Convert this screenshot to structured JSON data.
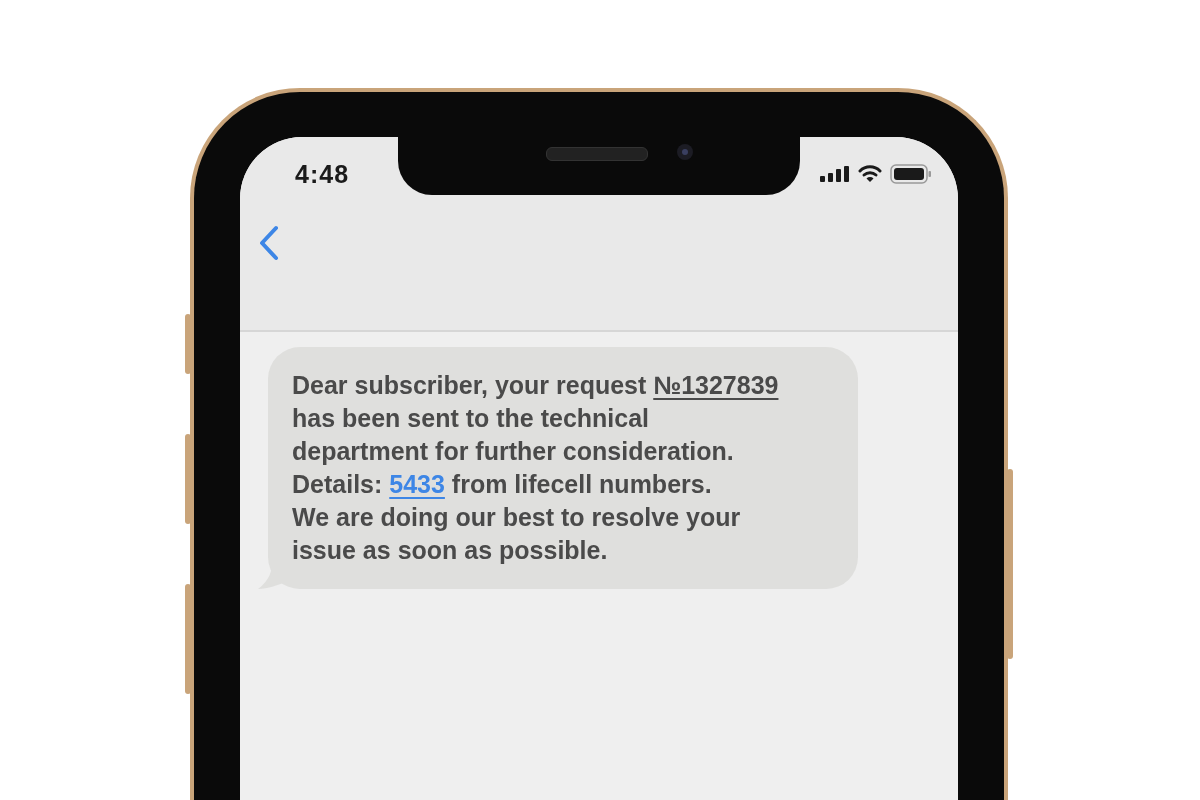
{
  "status_bar": {
    "time": "4:48"
  },
  "message": {
    "lines": [
      [
        {
          "kind": "text",
          "text": "Dear subscriber, your request "
        },
        {
          "kind": "underlined",
          "text": "№1327839"
        }
      ],
      [
        {
          "kind": "text",
          "text": "has been sent to the technical"
        }
      ],
      [
        {
          "kind": "text",
          "text": "department for further consideration."
        }
      ],
      [
        {
          "kind": "text",
          "text": "Details: "
        },
        {
          "kind": "link",
          "text": "5433"
        },
        {
          "kind": "text",
          "text": " from lifecell numbers."
        }
      ],
      [
        {
          "kind": "text",
          "text": "We are doing our best to resolve your"
        }
      ],
      [
        {
          "kind": "text",
          "text": "issue as soon as possible."
        }
      ]
    ]
  }
}
